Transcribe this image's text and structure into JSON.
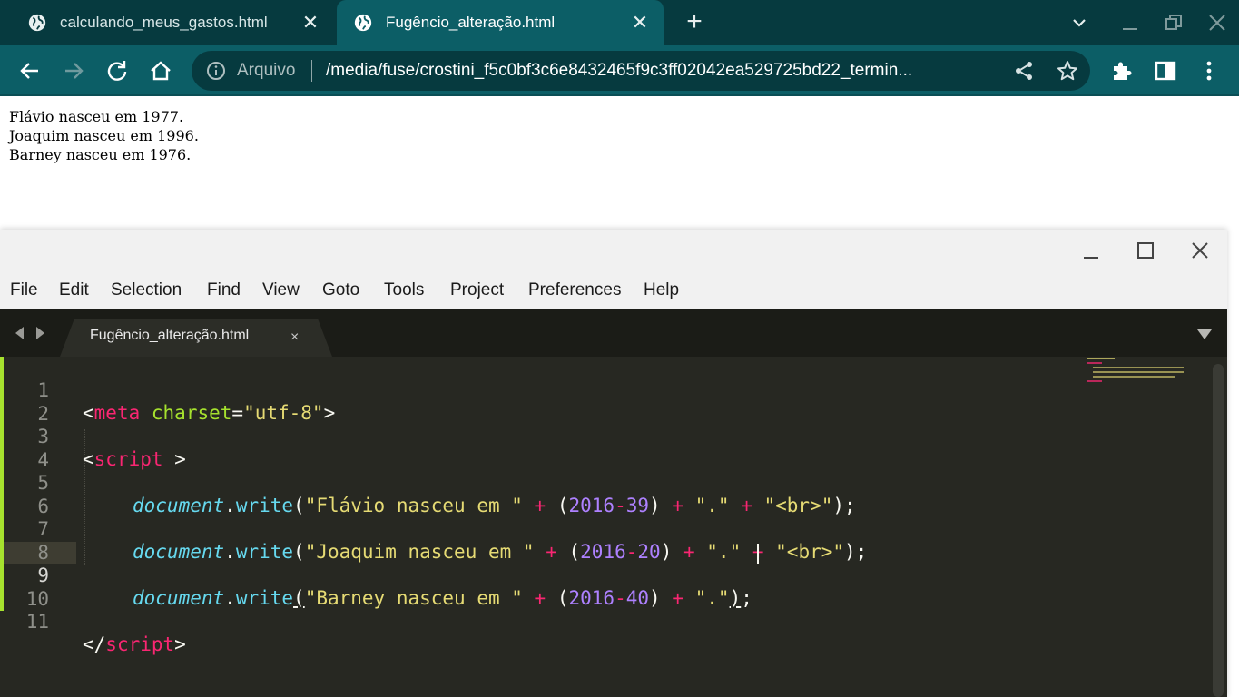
{
  "browser": {
    "tabs": [
      {
        "title": "calculando_meus_gastos.html",
        "active": false
      },
      {
        "title": "Fugêncio_alteração.html",
        "active": true
      }
    ],
    "omnibox": {
      "security_label": "Arquivo",
      "url": "/media/fuse/crostini_f5c0bf3c6e8432465f9c3ff02042ea529725bd22_termin..."
    },
    "colors": {
      "tabstrip": "#063a3f",
      "toolbar": "#0c5e66"
    }
  },
  "page": {
    "lines": [
      "Flávio nasceu em 1977.",
      "Joaquim nasceu em 1996.",
      "Barney nasceu em 1976."
    ]
  },
  "editor": {
    "menu": [
      "File",
      "Edit",
      "Selection",
      "Find",
      "View",
      "Goto",
      "Tools",
      "Project",
      "Preferences",
      "Help"
    ],
    "tab": {
      "title": "Fugêncio_alteração.html",
      "close": "×"
    },
    "line_numbers": [
      "1",
      "2",
      "3",
      "4",
      "5",
      "6",
      "7",
      "8",
      "9",
      "10",
      "11"
    ],
    "active_line": "9",
    "code": {
      "l1": {
        "open": "<",
        "tag": "meta",
        "sp": " ",
        "attr": "charset",
        "eq": "=",
        "val": "\"utf-8\"",
        "close": ">"
      },
      "l3": {
        "open": "<",
        "tag": "script",
        "close": " >"
      },
      "l5": {
        "obj": "document",
        "dot": ".",
        "fn": "write",
        "p1": "(",
        "s1": "\"Flávio nasceu em \"",
        "plus1": " + ",
        "p2": "(",
        "n1": "2016",
        "minus": "-",
        "n2": "39",
        "p3": ")",
        "plus2": " + ",
        "s2": "\".\"",
        "plus3": " + ",
        "s3": "\"<br>\"",
        "end": ");"
      },
      "l7": {
        "obj": "document",
        "dot": ".",
        "fn": "write",
        "p1": "(",
        "s1": "\"Joaquim nasceu em \"",
        "plus1": " + ",
        "p2": "(",
        "n1": "2016",
        "minus": "-",
        "n2": "20",
        "p3": ")",
        "plus2": " + ",
        "s2": "\".\"",
        "plus3": " + ",
        "s3": "\"<br>\"",
        "end": ");"
      },
      "l9": {
        "obj": "document",
        "dot": ".",
        "fn": "write",
        "p1": "(",
        "s1": "\"Barney nasceu em \"",
        "plus1": " + ",
        "p2": "(",
        "n1": "2016",
        "minus": "-",
        "n2": "40",
        "p3": ")",
        "plus2": " + ",
        "s2": "\".\"",
        "p4": ")",
        "end": ";"
      },
      "l11": {
        "open": "</",
        "tag": "script",
        "close": ">"
      }
    },
    "colors": {
      "background": "#272822",
      "keyword": "#f92672",
      "string": "#e6db74",
      "number": "#ae81ff",
      "attribute": "#a6e22e",
      "builtin": "#66d9ef"
    }
  }
}
